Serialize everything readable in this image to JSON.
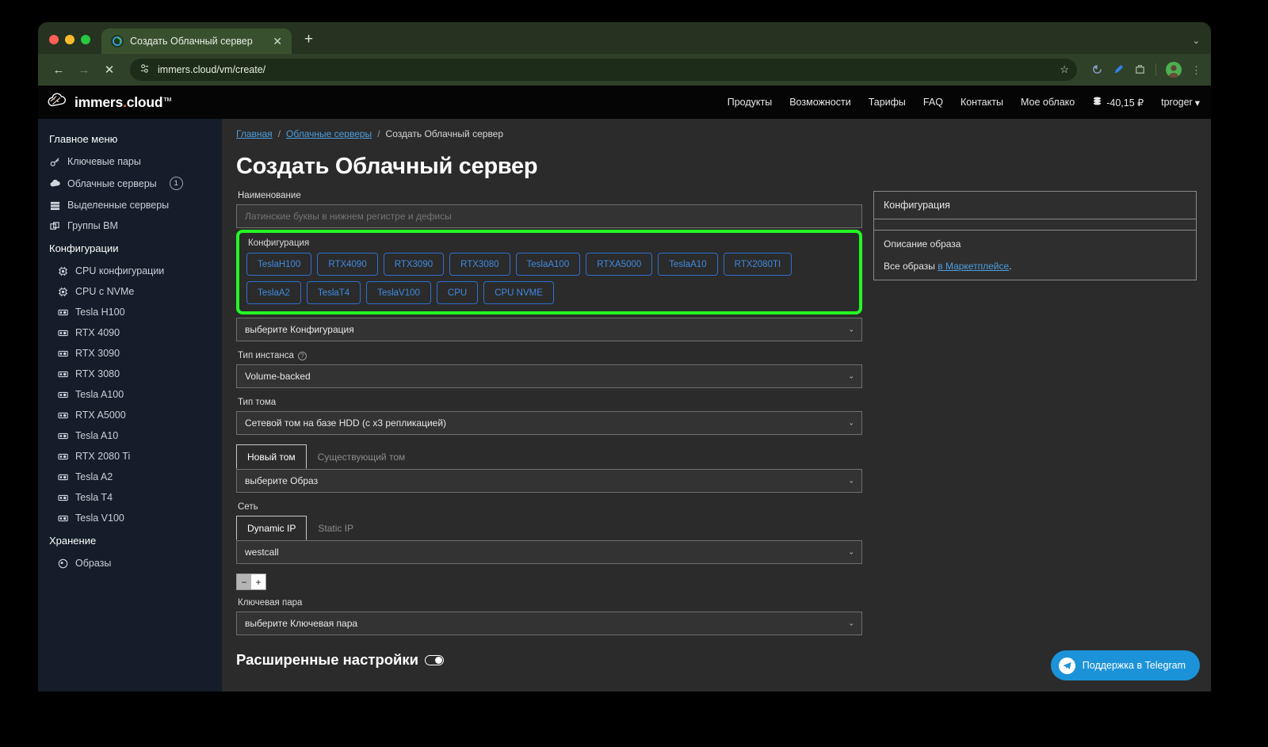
{
  "browser": {
    "tab_title": "Создать Облачный сервер",
    "tab_close": "✕",
    "new_tab": "+",
    "tabstrip_menu": "⌄",
    "back": "←",
    "forward": "→",
    "stop": "✕",
    "url": "immers.cloud/vm/create/",
    "omni_icon": "page-settings-icon",
    "star": "☆"
  },
  "site": {
    "logo_part1": "immers",
    "logo_dot": ".",
    "logo_part2": "cloud",
    "logo_tm": "TM",
    "nav": [
      {
        "label": "Продукты"
      },
      {
        "label": "Возможности"
      },
      {
        "label": "Тарифы"
      },
      {
        "label": "FAQ"
      },
      {
        "label": "Контакты"
      },
      {
        "label": "Мое облако"
      }
    ],
    "balance": "-40,15 ₽",
    "user": "tproger",
    "user_caret": "▾"
  },
  "sidebar": {
    "group_main": "Главное меню",
    "group_config": "Конфигурации",
    "group_storage": "Хранение",
    "main_items": [
      {
        "label": "Ключевые пары",
        "icon": "key-icon",
        "badge": ""
      },
      {
        "label": "Облачные серверы",
        "icon": "cloud-icon",
        "badge": "1"
      },
      {
        "label": "Выделенные серверы",
        "icon": "server-icon",
        "badge": ""
      },
      {
        "label": "Группы ВМ",
        "icon": "group-icon",
        "badge": ""
      }
    ],
    "config_items": [
      {
        "label": "CPU конфигурации",
        "icon": "cpu-icon"
      },
      {
        "label": "CPU с NVMe",
        "icon": "cpu-icon"
      },
      {
        "label": "Tesla H100",
        "icon": "gpu-icon"
      },
      {
        "label": "RTX 4090",
        "icon": "gpu-icon"
      },
      {
        "label": "RTX 3090",
        "icon": "gpu-icon"
      },
      {
        "label": "RTX 3080",
        "icon": "gpu-icon"
      },
      {
        "label": "Tesla A100",
        "icon": "gpu-icon"
      },
      {
        "label": "RTX A5000",
        "icon": "gpu-icon"
      },
      {
        "label": "Tesla A10",
        "icon": "gpu-icon"
      },
      {
        "label": "RTX 2080 Ti",
        "icon": "gpu-icon"
      },
      {
        "label": "Tesla A2",
        "icon": "gpu-icon"
      },
      {
        "label": "Tesla T4",
        "icon": "gpu-icon"
      },
      {
        "label": "Tesla V100",
        "icon": "gpu-icon"
      }
    ],
    "storage_items": [
      {
        "label": "Образы",
        "icon": "image-icon"
      }
    ]
  },
  "breadcrumb": {
    "home": "Главная",
    "sep1": "/",
    "parent": "Облачные серверы",
    "sep2": "/",
    "current": "Создать Облачный сервер"
  },
  "page": {
    "title": "Создать Облачный сервер"
  },
  "form": {
    "name_label": "Наименование",
    "name_placeholder": "Латинские буквы в нижнем регистре и дефисы",
    "name_value": "",
    "config_label": "Конфигурация",
    "config_chips": [
      "TeslaH100",
      "RTX4090",
      "RTX3090",
      "RTX3080",
      "TeslaA100",
      "RTXA5000",
      "TeslaA10",
      "RTX2080TI",
      "TeslaA2",
      "TeslaT4",
      "TeslaV100",
      "CPU",
      "CPU NVME"
    ],
    "config_select_value": "выберите Конфигурация",
    "instance_type_label": "Тип инстанса",
    "instance_type_value": "Volume-backed",
    "volume_type_label": "Тип тома",
    "volume_type_value": "Сетевой том на базе HDD (с x3 репликацией)",
    "volume_tabs": [
      {
        "label": "Новый том",
        "active": true
      },
      {
        "label": "Существующий том",
        "active": false
      }
    ],
    "image_select_value": "выберите Образ",
    "network_label": "Сеть",
    "network_tabs": [
      {
        "label": "Dynamic IP",
        "active": true
      },
      {
        "label": "Static IP",
        "active": false
      }
    ],
    "network_value": "westcall",
    "stepper_minus": "−",
    "stepper_plus": "+",
    "keypair_label": "Ключевая пара",
    "keypair_value": "выберите Ключевая пара",
    "advanced_title": "Расширенные настройки",
    "caret": "⌄"
  },
  "right_panel": {
    "header": "Конфигурация",
    "image_desc_title": "Описание образа",
    "all_images_prefix": "Все образы ",
    "all_images_link": "в Маркетплейсе",
    "all_images_suffix": "."
  },
  "telegram": {
    "label": "Поддержка в Telegram",
    "icon": "telegram-icon"
  },
  "colors": {
    "highlight": "#23f723",
    "chip_border": "#2f6fce",
    "chip_text": "#3f8ae0",
    "link": "#4c9fe0",
    "sidebar_bg": "#141d29",
    "main_bg": "#2b2b2b",
    "telegram": "#1c93d9",
    "logo_accent": "#ef6c16"
  }
}
